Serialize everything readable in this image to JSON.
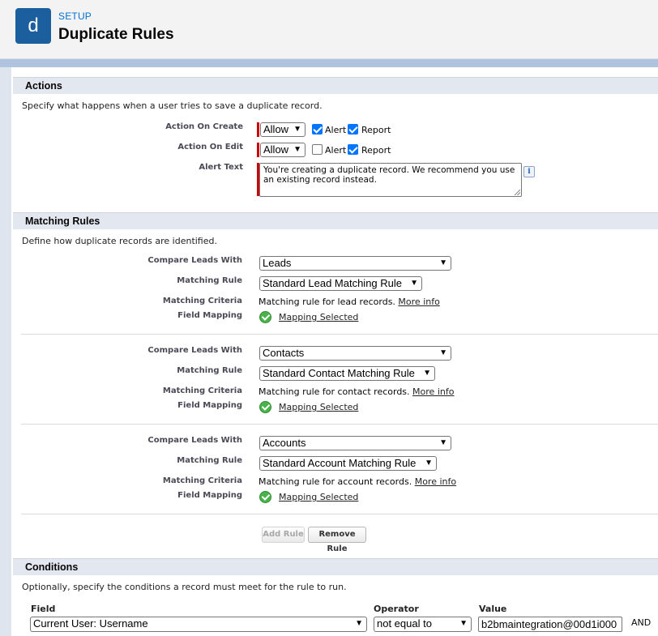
{
  "header": {
    "logo_letter": "d",
    "setup_label": "SETUP",
    "title": "Duplicate Rules"
  },
  "actions": {
    "section_title": "Actions",
    "description": "Specify what happens when a user tries to save a duplicate record.",
    "on_create": {
      "label": "Action On Create",
      "value": "Allow",
      "alert_label": "Alert",
      "alert_checked": true,
      "report_label": "Report",
      "report_checked": true
    },
    "on_edit": {
      "label": "Action On Edit",
      "value": "Allow",
      "alert_label": "Alert",
      "alert_checked": false,
      "report_label": "Report",
      "report_checked": true
    },
    "alert_text": {
      "label": "Alert Text",
      "value": "You're creating a duplicate record. We recommend you use an existing record instead.",
      "info_icon": "i"
    }
  },
  "matching": {
    "section_title": "Matching Rules",
    "description": "Define how duplicate records are identified.",
    "labels": {
      "compare": "Compare Leads With",
      "rule": "Matching Rule",
      "criteria": "Matching Criteria",
      "mapping": "Field Mapping"
    },
    "rules": [
      {
        "compare": "Leads",
        "rule": "Standard Lead Matching Rule",
        "criteria": "Matching rule for lead records.",
        "more": "More info",
        "mapping": "Mapping Selected"
      },
      {
        "compare": "Contacts",
        "rule": "Standard Contact Matching Rule",
        "criteria": "Matching rule for contact records.",
        "more": "More info",
        "mapping": "Mapping Selected"
      },
      {
        "compare": "Accounts",
        "rule": "Standard Account Matching Rule",
        "criteria": "Matching rule for account records.",
        "more": "More info",
        "mapping": "Mapping Selected"
      }
    ],
    "add_rule": "Add Rule",
    "remove_rule": "Remove Rule"
  },
  "conditions": {
    "section_title": "Conditions",
    "description": "Optionally, specify the conditions a record must meet for the rule to run.",
    "headers": {
      "field": "Field",
      "operator": "Operator",
      "value": "Value"
    },
    "row": {
      "field": "Current User: Username",
      "operator": "not equal to",
      "value": "b2bmaintegration@00d1i000",
      "conjunction": "AND"
    }
  }
}
